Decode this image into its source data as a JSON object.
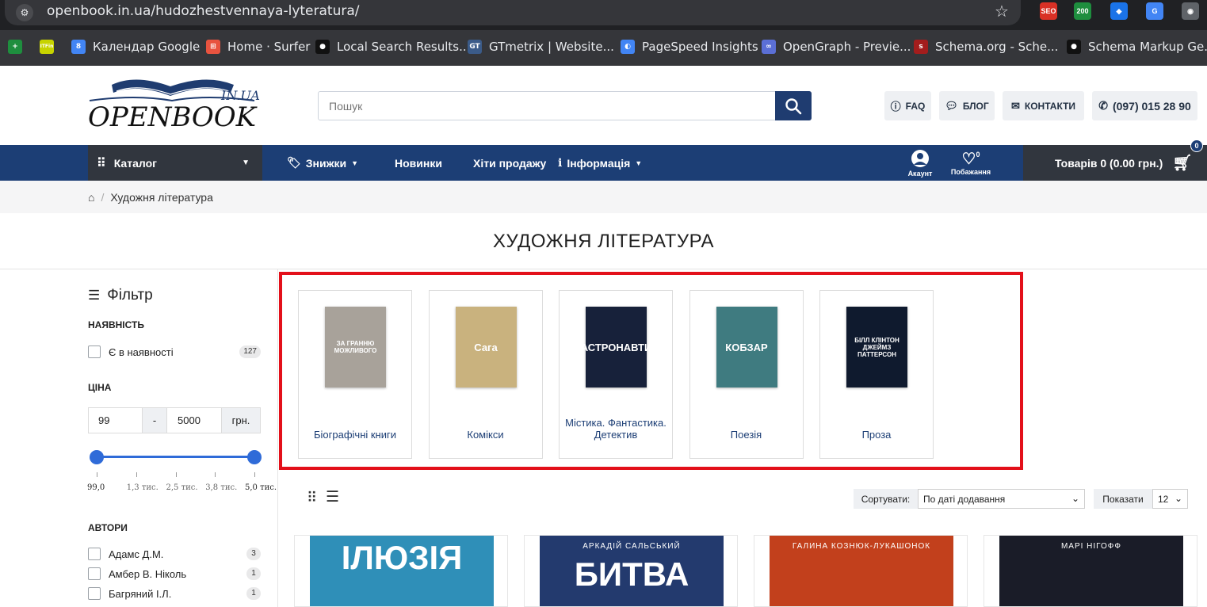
{
  "browser": {
    "url": "openbook.in.ua/hudozhestvennaya-lyteratura/",
    "extensions": [
      {
        "name": "seo-ext-icon",
        "label": "SEO",
        "color": "#d93025"
      },
      {
        "name": "status-ext-icon",
        "label": "200",
        "color": "#1e8e3e"
      },
      {
        "name": "tag-ext-icon",
        "label": "◆",
        "color": "#1a73e8"
      },
      {
        "name": "translate-ext-icon",
        "label": "G",
        "color": "#4285f4"
      },
      {
        "name": "camera-ext-icon",
        "label": "◉",
        "color": "#5f6368"
      }
    ],
    "bookmarks": [
      {
        "label": "",
        "icon": "+",
        "color": "#1e8e3e"
      },
      {
        "label": "",
        "icon": "ITFin",
        "color": "#c7d300"
      },
      {
        "label": "Календар Google",
        "icon": "8",
        "color": "#4285f4"
      },
      {
        "label": "Home · Surfer",
        "icon": "⊞",
        "color": "#e8533f"
      },
      {
        "label": "Local Search Results...",
        "icon": "●",
        "color": "#111111"
      },
      {
        "label": "GTmetrix | Website...",
        "icon": "GT",
        "color": "#3b5b89"
      },
      {
        "label": "PageSpeed Insights",
        "icon": "◐",
        "color": "#4285f4"
      },
      {
        "label": "OpenGraph - Previe...",
        "icon": "∞",
        "color": "#5b6fd6"
      },
      {
        "label": "Schema.org - Sche...",
        "icon": "s",
        "color": "#a31d1d"
      },
      {
        "label": "Schema Markup Ge...",
        "icon": "●",
        "color": "#111111"
      }
    ]
  },
  "header": {
    "logo_main": "OPENBOOK",
    "logo_suffix": "IN.UA",
    "search_placeholder": "Пошук",
    "faq": "FAQ",
    "blog": "БЛОГ",
    "contacts": "КОНТАКТИ",
    "phone": "(097) 015 28 90"
  },
  "nav": {
    "catalog": "Каталог",
    "discounts": "Знижки",
    "new": "Новинки",
    "bestsellers": "Хіти продажу",
    "info": "Інформація",
    "account": "Акаунт",
    "wishlist": "Побажання",
    "wishlist_count": "0",
    "cart": "Товарів 0 (0.00 грн.)",
    "cart_count": "0"
  },
  "breadcrumb": {
    "current": "Художня література"
  },
  "page_title": "ХУДОЖНЯ ЛІТЕРАТУРА",
  "filter": {
    "title": "Фільтр",
    "availability_title": "НАЯВНІСТЬ",
    "in_stock": "Є в наявності",
    "in_stock_count": "127",
    "price_title": "ЦІНА",
    "price_min": "99",
    "price_sep": "-",
    "price_max": "5000",
    "currency": "грн.",
    "range_low": 0,
    "range_high": 1,
    "ticks": [
      "99,0",
      "1,3 тис.",
      "2,5 тис.",
      "3,8 тис.",
      "5,0 тис."
    ],
    "authors_title": "АВТОРИ",
    "authors": [
      {
        "name": "Адамс Д.М.",
        "count": "3"
      },
      {
        "name": "Амбер В. Ніколь",
        "count": "1"
      },
      {
        "name": "Багряний І.Л.",
        "count": "1"
      }
    ]
  },
  "categories": [
    {
      "label": "Біографічні книги",
      "cover_color": "#a8a29a",
      "cover_text": "ЗА ГРАННЮ МОЖЛИВОГО"
    },
    {
      "label": "Комікси",
      "cover_color": "#c9b27e",
      "cover_text": "Сага"
    },
    {
      "label": "Містика. Фантастика. Детектив",
      "cover_color": "#17213a",
      "cover_text": "АСТРОНАВТИ"
    },
    {
      "label": "Поезія",
      "cover_color": "#3f7b80",
      "cover_text": "КОБЗАР"
    },
    {
      "label": "Проза",
      "cover_color": "#0f1a2e",
      "cover_text": "БІЛЛ КЛІНТОН ДЖЕЙМЗ ПАТТЕРСОН"
    }
  ],
  "toolbar": {
    "sort_label": "Сортувати:",
    "sort_value": "По даті додавання",
    "show_label": "Показати",
    "show_value": "12"
  },
  "products": [
    {
      "cover_text": "ІЛЮЗІЯ",
      "top_text": "",
      "color": "#2f8fb8"
    },
    {
      "cover_text": "БИТВА",
      "top_text": "АРКАДІЙ  САЛЬСЬКИЙ",
      "color": "#233a6e"
    },
    {
      "cover_text": "",
      "top_text": "ГАЛИНА КОЗНЮК-ЛУКАШОНОК",
      "color": "#c2401c"
    },
    {
      "cover_text": "",
      "top_text": "МАРІ НІГОФФ",
      "color": "#1a1c28"
    }
  ],
  "colors": {
    "navy": "#1c3e75",
    "dark": "#31363e",
    "accent": "#2f6bd8",
    "highlight": "#e3101a"
  }
}
